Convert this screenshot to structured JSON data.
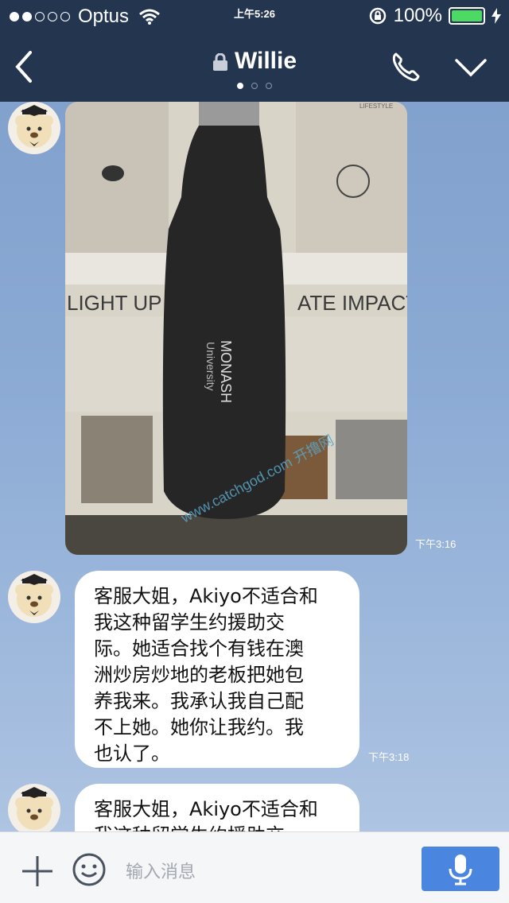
{
  "status_bar": {
    "carrier": "Optus",
    "time": "上午5:26",
    "battery": "100%"
  },
  "header": {
    "title": "Willie",
    "icons": [
      "back-chevron-icon",
      "lock-icon",
      "phone-icon",
      "chevron-down-icon"
    ],
    "page_dots": 3
  },
  "messages": [
    {
      "type": "image",
      "time": "下午3:16",
      "image_text": {
        "headline_left": "LIGHT UP F",
        "headline_right": "ATE IMPACT",
        "bottle_brand": "MONASH",
        "bottle_sub": "University",
        "corner": "LIFESTYLE",
        "watermark": "www.catchgod.com 开撸网"
      }
    },
    {
      "type": "text",
      "time": "下午3:18",
      "text": "客服大姐，Akiyo不适合和\n我这种留学生约援助交\n际。她适合找个有钱在澳\n洲炒房炒地的老板把她包\n养我来。我承认我自己配\n不上她。她你让我约。我\n也认了。"
    },
    {
      "type": "text",
      "text": "客服大姐，Akiyo不适合和\n我这种留学生约援助交"
    }
  ],
  "input_bar": {
    "placeholder": "输入消息"
  },
  "colors": {
    "header": "#243550",
    "accent": "#4a86e0",
    "battery": "#4cd964"
  }
}
